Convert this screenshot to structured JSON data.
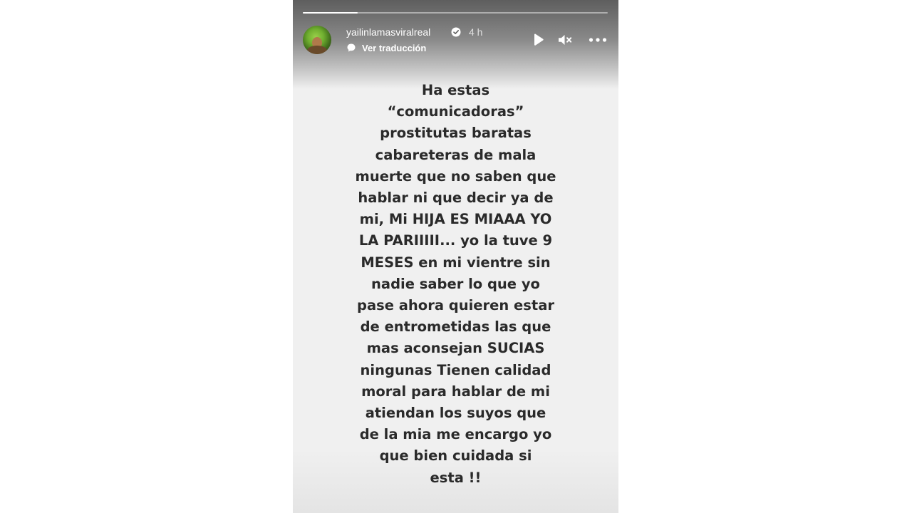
{
  "story": {
    "progress": 0.18,
    "author": {
      "username": "yailinlamasviralreal",
      "verified": true,
      "time_ago": "4 h",
      "avatar_icon": "profile-photo-avatar"
    },
    "translate_label": "Ver traducción",
    "controls": {
      "play_icon": "play-icon",
      "mute_icon": "speaker-muted-icon",
      "more_icon": "more-options-icon"
    },
    "text_lines": [
      "Ha estas",
      "“comunicadoras”",
      "prostitutas baratas",
      "cabareteras de mala",
      "muerte que no saben que",
      "hablar ni que decir ya de",
      "mi, Mi HIJA ES MIAAA YO",
      "LA PARIIIII... yo la tuve 9",
      "MESES en mi vientre sin",
      "nadie saber lo que yo",
      "pase ahora quieren estar",
      "de entrometidas las que",
      "mas aconsejan SUCIAS",
      "ningunas Tienen calidad",
      "moral para hablar de mi",
      "atiendan los suyos que",
      "de la mia me encargo yo",
      "que bien cuidada si",
      "esta !!"
    ],
    "colors": {
      "background": "#f0f0f0",
      "text": "#2a2a2a",
      "header_text": "#ffffff"
    }
  }
}
